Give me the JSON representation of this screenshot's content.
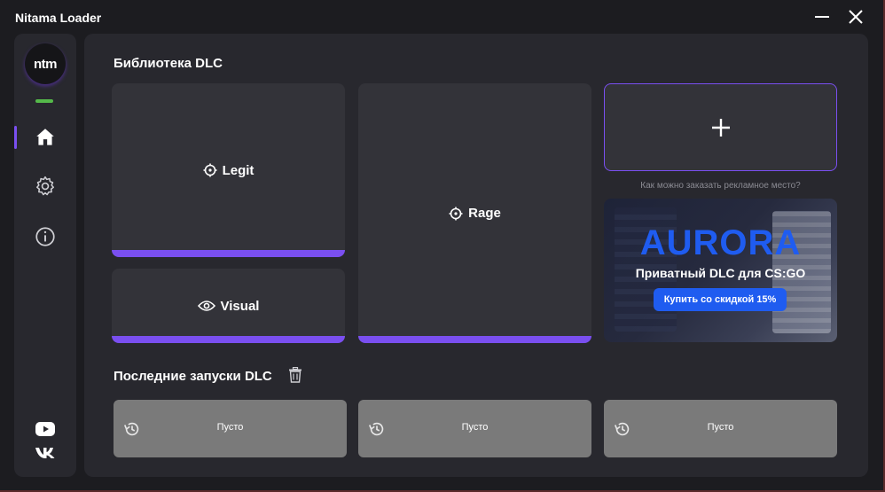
{
  "window": {
    "title": "Nitama Loader"
  },
  "sidebar": {
    "logo_text": "ntm",
    "items": [
      {
        "icon": "home-icon",
        "active": true
      },
      {
        "icon": "gear-icon",
        "active": false
      },
      {
        "icon": "info-icon",
        "active": false
      }
    ],
    "social": [
      "youtube-icon",
      "vk-icon"
    ],
    "status_color": "#55b94a"
  },
  "library": {
    "title": "Библиотека DLC",
    "cards": {
      "legit": "Legit",
      "visual": "Visual",
      "rage": "Rage"
    },
    "add_icon": "plus-icon",
    "ad_question": "Как можно заказать рекламное место?"
  },
  "ad": {
    "brand": "AURORA",
    "subtitle": "Приватный DLC для CS:GO",
    "cta": "Купить со скидкой 15%"
  },
  "recent": {
    "title": "Последние запуски DLC",
    "slots": [
      "Пусто",
      "Пусто",
      "Пусто"
    ]
  },
  "colors": {
    "accent": "#7a4ff0",
    "background": "#1c1c20",
    "panel": "#28282e",
    "card": "#333339",
    "ad_blue": "#1f5cf0"
  }
}
